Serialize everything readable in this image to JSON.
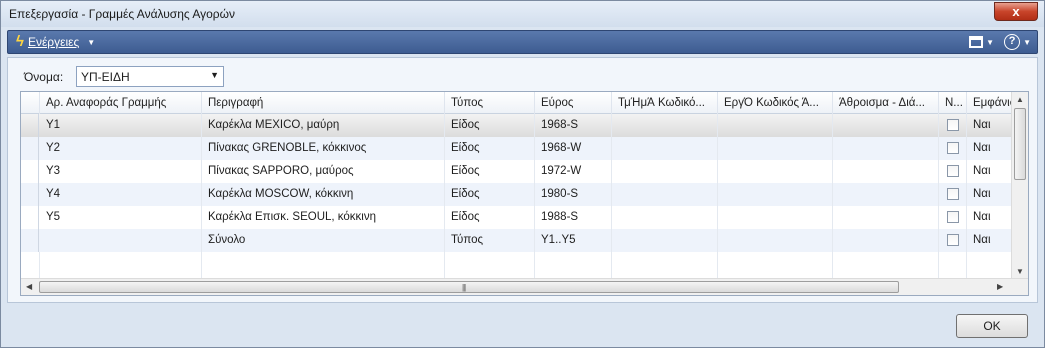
{
  "window": {
    "title": "Επεξεργασία - Γραμμές Ανάλυσης Αγορών",
    "close_label": "x"
  },
  "actions": {
    "label": "Ενέργειες",
    "help_label": "?"
  },
  "name_field": {
    "label": "Όνομα:",
    "value": "ΥΠ-ΕΙΔΗ"
  },
  "grid": {
    "columns": [
      "Αρ. Αναφοράς Γραμμής",
      "Περιγραφή",
      "Τύπος",
      "Εύρος",
      "ΤμΉμΆ Κωδικό...",
      "ΕργΌ Κωδικός Ά...",
      "Άθροισμα - Διά...",
      "Ν...",
      "Εμφάνιση"
    ],
    "rows": [
      {
        "ref": "Y1",
        "desc": "Καρέκλα MEXICO, μαύρη",
        "type": "Είδος",
        "range": "1968-S",
        "show": "Ναι"
      },
      {
        "ref": "Y2",
        "desc": "Πίνακας GRENOBLE, κόκκινος",
        "type": "Είδος",
        "range": "1968-W",
        "show": "Ναι"
      },
      {
        "ref": "Y3",
        "desc": "Πίνακας SAPPORO, μαύρος",
        "type": "Είδος",
        "range": "1972-W",
        "show": "Ναι"
      },
      {
        "ref": "Y4",
        "desc": "Καρέκλα MOSCOW, κόκκινη",
        "type": "Είδος",
        "range": "1980-S",
        "show": "Ναι"
      },
      {
        "ref": "Y5",
        "desc": "Καρέκλα Επισκ. SEOUL, κόκκινη",
        "type": "Είδος",
        "range": "1988-S",
        "show": "Ναι"
      },
      {
        "ref": "",
        "desc": "Σύνολο",
        "type": "Τύπος",
        "range": "Y1..Y5",
        "show": "Ναι"
      }
    ]
  },
  "footer": {
    "ok_label": "OK"
  }
}
